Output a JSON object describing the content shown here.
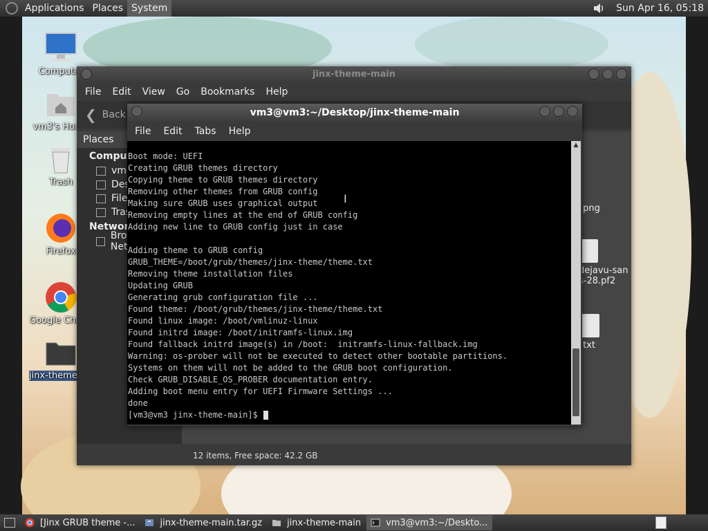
{
  "top_panel": {
    "menus": [
      "Applications",
      "Places",
      "System"
    ],
    "clock": "Sun Apr 16, 05:18"
  },
  "desktop_icons": [
    {
      "label": "Computer",
      "icon": "computer-icon"
    },
    {
      "label": "vm3's Home",
      "icon": "home-folder-icon"
    },
    {
      "label": "Trash",
      "icon": "trash-icon"
    },
    {
      "label": "Firefox",
      "icon": "firefox-icon"
    },
    {
      "label": "Google Chrome",
      "icon": "chrome-icon"
    },
    {
      "label": "jinx-theme-main",
      "icon": "folder-icon"
    }
  ],
  "file_manager": {
    "title": "jinx-theme-main",
    "menus": [
      "File",
      "Edit",
      "View",
      "Go",
      "Bookmarks",
      "Help"
    ],
    "back_label": "Back",
    "sidebar_header": "Places",
    "sidebar": {
      "computer_label": "Computer",
      "computer_items": [
        "vm3",
        "Desktop",
        "File System",
        "Trash"
      ],
      "network_label": "Network",
      "network_items": [
        "Browse Network"
      ]
    },
    "visible_files": [
      ".png",
      "dejavu-sans-28.pf2",
      ".txt"
    ],
    "status": "12 items, Free space: 42.2 GB"
  },
  "terminal": {
    "title": "vm3@vm3:~/Desktop/jinx-theme-main",
    "menus": [
      "File",
      "Edit",
      "Tabs",
      "Help"
    ],
    "lines": [
      "Boot mode: UEFI",
      "Creating GRUB themes directory",
      "Copying theme to GRUB themes directory",
      "Removing other themes from GRUB config",
      "Making sure GRUB uses graphical output",
      "Removing empty lines at the end of GRUB config",
      "Adding new line to GRUB config just in case",
      "",
      "Adding theme to GRUB config",
      "GRUB_THEME=/boot/grub/themes/jinx-theme/theme.txt",
      "Removing theme installation files",
      "Updating GRUB",
      "Generating grub configuration file ...",
      "Found theme: /boot/grub/themes/jinx-theme/theme.txt",
      "Found linux image: /boot/vmlinuz-linux",
      "Found initrd image: /boot/initramfs-linux.img",
      "Found fallback initrd image(s) in /boot:  initramfs-linux-fallback.img",
      "Warning: os-prober will not be executed to detect other bootable partitions.",
      "Systems on them will not be added to the GRUB boot configuration.",
      "Check GRUB_DISABLE_OS_PROBER documentation entry.",
      "Adding boot menu entry for UEFI Firmware Settings ...",
      "done"
    ],
    "prompt": "[vm3@vm3 jinx-theme-main]$ "
  },
  "taskbar": {
    "tasks": [
      {
        "label": "[Jinx GRUB theme -...",
        "icon": "chrome-icon",
        "active": false
      },
      {
        "label": "jinx-theme-main.tar.gz",
        "icon": "archive-icon",
        "active": false
      },
      {
        "label": "jinx-theme-main",
        "icon": "folder-icon",
        "active": false
      },
      {
        "label": "vm3@vm3:~/Deskto...",
        "icon": "terminal-icon",
        "active": true
      }
    ]
  },
  "colors": {
    "panel": "#2e2e2e",
    "terminal_bg": "#000000",
    "terminal_fg": "#c8c8c8",
    "window_bg": "#3a3a3a"
  }
}
